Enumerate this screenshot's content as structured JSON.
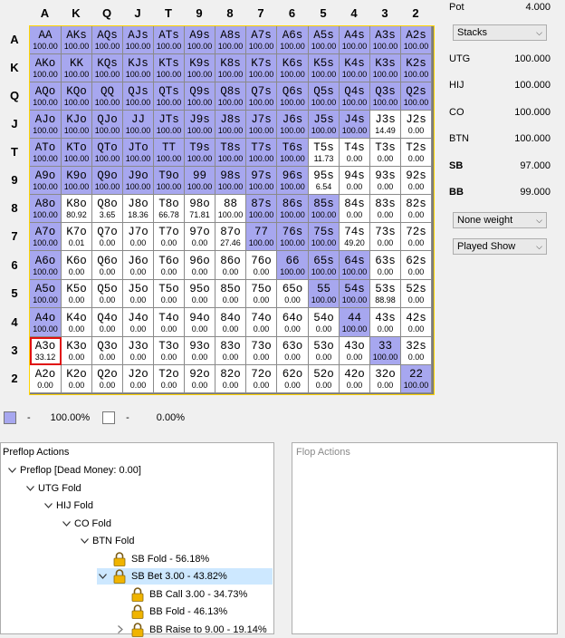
{
  "grid": {
    "ranks": [
      "A",
      "K",
      "Q",
      "J",
      "T",
      "9",
      "8",
      "7",
      "6",
      "5",
      "4",
      "3",
      "2"
    ],
    "rows": [
      [
        {
          "h": "AA",
          "v": "100.00"
        },
        {
          "h": "AKs",
          "v": "100.00"
        },
        {
          "h": "AQs",
          "v": "100.00"
        },
        {
          "h": "AJs",
          "v": "100.00"
        },
        {
          "h": "ATs",
          "v": "100.00"
        },
        {
          "h": "A9s",
          "v": "100.00"
        },
        {
          "h": "A8s",
          "v": "100.00"
        },
        {
          "h": "A7s",
          "v": "100.00"
        },
        {
          "h": "A6s",
          "v": "100.00"
        },
        {
          "h": "A5s",
          "v": "100.00"
        },
        {
          "h": "A4s",
          "v": "100.00"
        },
        {
          "h": "A3s",
          "v": "100.00"
        },
        {
          "h": "A2s",
          "v": "100.00"
        }
      ],
      [
        {
          "h": "AKo",
          "v": "100.00"
        },
        {
          "h": "KK",
          "v": "100.00"
        },
        {
          "h": "KQs",
          "v": "100.00"
        },
        {
          "h": "KJs",
          "v": "100.00"
        },
        {
          "h": "KTs",
          "v": "100.00"
        },
        {
          "h": "K9s",
          "v": "100.00"
        },
        {
          "h": "K8s",
          "v": "100.00"
        },
        {
          "h": "K7s",
          "v": "100.00"
        },
        {
          "h": "K6s",
          "v": "100.00"
        },
        {
          "h": "K5s",
          "v": "100.00"
        },
        {
          "h": "K4s",
          "v": "100.00"
        },
        {
          "h": "K3s",
          "v": "100.00"
        },
        {
          "h": "K2s",
          "v": "100.00"
        }
      ],
      [
        {
          "h": "AQo",
          "v": "100.00"
        },
        {
          "h": "KQo",
          "v": "100.00"
        },
        {
          "h": "QQ",
          "v": "100.00"
        },
        {
          "h": "QJs",
          "v": "100.00"
        },
        {
          "h": "QTs",
          "v": "100.00"
        },
        {
          "h": "Q9s",
          "v": "100.00"
        },
        {
          "h": "Q8s",
          "v": "100.00"
        },
        {
          "h": "Q7s",
          "v": "100.00"
        },
        {
          "h": "Q6s",
          "v": "100.00"
        },
        {
          "h": "Q5s",
          "v": "100.00"
        },
        {
          "h": "Q4s",
          "v": "100.00"
        },
        {
          "h": "Q3s",
          "v": "100.00"
        },
        {
          "h": "Q2s",
          "v": "100.00"
        }
      ],
      [
        {
          "h": "AJo",
          "v": "100.00"
        },
        {
          "h": "KJo",
          "v": "100.00"
        },
        {
          "h": "QJo",
          "v": "100.00"
        },
        {
          "h": "JJ",
          "v": "100.00"
        },
        {
          "h": "JTs",
          "v": "100.00"
        },
        {
          "h": "J9s",
          "v": "100.00"
        },
        {
          "h": "J8s",
          "v": "100.00"
        },
        {
          "h": "J7s",
          "v": "100.00"
        },
        {
          "h": "J6s",
          "v": "100.00"
        },
        {
          "h": "J5s",
          "v": "100.00"
        },
        {
          "h": "J4s",
          "v": "100.00"
        },
        {
          "h": "J3s",
          "v": "14.49"
        },
        {
          "h": "J2s",
          "v": "0.00"
        }
      ],
      [
        {
          "h": "ATo",
          "v": "100.00"
        },
        {
          "h": "KTo",
          "v": "100.00"
        },
        {
          "h": "QTo",
          "v": "100.00"
        },
        {
          "h": "JTo",
          "v": "100.00"
        },
        {
          "h": "TT",
          "v": "100.00"
        },
        {
          "h": "T9s",
          "v": "100.00"
        },
        {
          "h": "T8s",
          "v": "100.00"
        },
        {
          "h": "T7s",
          "v": "100.00"
        },
        {
          "h": "T6s",
          "v": "100.00"
        },
        {
          "h": "T5s",
          "v": "11.73"
        },
        {
          "h": "T4s",
          "v": "0.00"
        },
        {
          "h": "T3s",
          "v": "0.00"
        },
        {
          "h": "T2s",
          "v": "0.00"
        }
      ],
      [
        {
          "h": "A9o",
          "v": "100.00"
        },
        {
          "h": "K9o",
          "v": "100.00"
        },
        {
          "h": "Q9o",
          "v": "100.00"
        },
        {
          "h": "J9o",
          "v": "100.00"
        },
        {
          "h": "T9o",
          "v": "100.00"
        },
        {
          "h": "99",
          "v": "100.00"
        },
        {
          "h": "98s",
          "v": "100.00"
        },
        {
          "h": "97s",
          "v": "100.00"
        },
        {
          "h": "96s",
          "v": "100.00"
        },
        {
          "h": "95s",
          "v": "6.54"
        },
        {
          "h": "94s",
          "v": "0.00"
        },
        {
          "h": "93s",
          "v": "0.00"
        },
        {
          "h": "92s",
          "v": "0.00"
        }
      ],
      [
        {
          "h": "A8o",
          "v": "100.00"
        },
        {
          "h": "K8o",
          "v": "80.92"
        },
        {
          "h": "Q8o",
          "v": "3.65"
        },
        {
          "h": "J8o",
          "v": "18.36"
        },
        {
          "h": "T8o",
          "v": "66.78"
        },
        {
          "h": "98o",
          "v": "71.81"
        },
        {
          "h": "88",
          "v": "100.00"
        },
        {
          "h": "87s",
          "v": "100.00"
        },
        {
          "h": "86s",
          "v": "100.00"
        },
        {
          "h": "85s",
          "v": "100.00"
        },
        {
          "h": "84s",
          "v": "0.00"
        },
        {
          "h": "83s",
          "v": "0.00"
        },
        {
          "h": "82s",
          "v": "0.00"
        }
      ],
      [
        {
          "h": "A7o",
          "v": "100.00"
        },
        {
          "h": "K7o",
          "v": "0.01"
        },
        {
          "h": "Q7o",
          "v": "0.00"
        },
        {
          "h": "J7o",
          "v": "0.00"
        },
        {
          "h": "T7o",
          "v": "0.00"
        },
        {
          "h": "97o",
          "v": "0.00"
        },
        {
          "h": "87o",
          "v": "27.46"
        },
        {
          "h": "77",
          "v": "100.00"
        },
        {
          "h": "76s",
          "v": "100.00"
        },
        {
          "h": "75s",
          "v": "100.00"
        },
        {
          "h": "74s",
          "v": "49.20"
        },
        {
          "h": "73s",
          "v": "0.00"
        },
        {
          "h": "72s",
          "v": "0.00"
        }
      ],
      [
        {
          "h": "A6o",
          "v": "100.00"
        },
        {
          "h": "K6o",
          "v": "0.00"
        },
        {
          "h": "Q6o",
          "v": "0.00"
        },
        {
          "h": "J6o",
          "v": "0.00"
        },
        {
          "h": "T6o",
          "v": "0.00"
        },
        {
          "h": "96o",
          "v": "0.00"
        },
        {
          "h": "86o",
          "v": "0.00"
        },
        {
          "h": "76o",
          "v": "0.00"
        },
        {
          "h": "66",
          "v": "100.00"
        },
        {
          "h": "65s",
          "v": "100.00"
        },
        {
          "h": "64s",
          "v": "100.00"
        },
        {
          "h": "63s",
          "v": "0.00"
        },
        {
          "h": "62s",
          "v": "0.00"
        }
      ],
      [
        {
          "h": "A5o",
          "v": "100.00"
        },
        {
          "h": "K5o",
          "v": "0.00"
        },
        {
          "h": "Q5o",
          "v": "0.00"
        },
        {
          "h": "J5o",
          "v": "0.00"
        },
        {
          "h": "T5o",
          "v": "0.00"
        },
        {
          "h": "95o",
          "v": "0.00"
        },
        {
          "h": "85o",
          "v": "0.00"
        },
        {
          "h": "75o",
          "v": "0.00"
        },
        {
          "h": "65o",
          "v": "0.00"
        },
        {
          "h": "55",
          "v": "100.00"
        },
        {
          "h": "54s",
          "v": "100.00"
        },
        {
          "h": "53s",
          "v": "88.98"
        },
        {
          "h": "52s",
          "v": "0.00"
        }
      ],
      [
        {
          "h": "A4o",
          "v": "100.00"
        },
        {
          "h": "K4o",
          "v": "0.00"
        },
        {
          "h": "Q4o",
          "v": "0.00"
        },
        {
          "h": "J4o",
          "v": "0.00"
        },
        {
          "h": "T4o",
          "v": "0.00"
        },
        {
          "h": "94o",
          "v": "0.00"
        },
        {
          "h": "84o",
          "v": "0.00"
        },
        {
          "h": "74o",
          "v": "0.00"
        },
        {
          "h": "64o",
          "v": "0.00"
        },
        {
          "h": "54o",
          "v": "0.00"
        },
        {
          "h": "44",
          "v": "100.00"
        },
        {
          "h": "43s",
          "v": "0.00"
        },
        {
          "h": "42s",
          "v": "0.00"
        }
      ],
      [
        {
          "h": "A3o",
          "v": "33.12"
        },
        {
          "h": "K3o",
          "v": "0.00"
        },
        {
          "h": "Q3o",
          "v": "0.00"
        },
        {
          "h": "J3o",
          "v": "0.00"
        },
        {
          "h": "T3o",
          "v": "0.00"
        },
        {
          "h": "93o",
          "v": "0.00"
        },
        {
          "h": "83o",
          "v": "0.00"
        },
        {
          "h": "73o",
          "v": "0.00"
        },
        {
          "h": "63o",
          "v": "0.00"
        },
        {
          "h": "53o",
          "v": "0.00"
        },
        {
          "h": "43o",
          "v": "0.00"
        },
        {
          "h": "33",
          "v": "100.00"
        },
        {
          "h": "32s",
          "v": "0.00"
        }
      ],
      [
        {
          "h": "A2o",
          "v": "0.00"
        },
        {
          "h": "K2o",
          "v": "0.00"
        },
        {
          "h": "Q2o",
          "v": "0.00"
        },
        {
          "h": "J2o",
          "v": "0.00"
        },
        {
          "h": "T2o",
          "v": "0.00"
        },
        {
          "h": "92o",
          "v": "0.00"
        },
        {
          "h": "82o",
          "v": "0.00"
        },
        {
          "h": "72o",
          "v": "0.00"
        },
        {
          "h": "62o",
          "v": "0.00"
        },
        {
          "h": "52o",
          "v": "0.00"
        },
        {
          "h": "42o",
          "v": "0.00"
        },
        {
          "h": "32o",
          "v": "0.00"
        },
        {
          "h": "22",
          "v": "100.00"
        }
      ]
    ],
    "highlighted": [
      [
        1,
        1,
        1,
        1,
        1,
        1,
        1,
        1,
        1,
        1,
        1,
        1,
        1
      ],
      [
        1,
        1,
        1,
        1,
        1,
        1,
        1,
        1,
        1,
        1,
        1,
        1,
        1
      ],
      [
        1,
        1,
        1,
        1,
        1,
        1,
        1,
        1,
        1,
        1,
        1,
        1,
        1
      ],
      [
        1,
        1,
        1,
        1,
        1,
        1,
        1,
        1,
        1,
        1,
        1,
        0,
        0
      ],
      [
        1,
        1,
        1,
        1,
        1,
        1,
        1,
        1,
        1,
        0,
        0,
        0,
        0
      ],
      [
        1,
        1,
        1,
        1,
        1,
        1,
        1,
        1,
        1,
        0,
        0,
        0,
        0
      ],
      [
        1,
        0,
        0,
        0,
        0,
        0,
        0,
        1,
        1,
        1,
        0,
        0,
        0
      ],
      [
        1,
        0,
        0,
        0,
        0,
        0,
        0,
        1,
        1,
        1,
        0,
        0,
        0
      ],
      [
        1,
        0,
        0,
        0,
        0,
        0,
        0,
        0,
        1,
        1,
        1,
        0,
        0
      ],
      [
        1,
        0,
        0,
        0,
        0,
        0,
        0,
        0,
        0,
        1,
        1,
        0,
        0
      ],
      [
        1,
        0,
        0,
        0,
        0,
        0,
        0,
        0,
        0,
        0,
        1,
        0,
        0
      ],
      [
        0,
        0,
        0,
        0,
        0,
        0,
        0,
        0,
        0,
        0,
        0,
        1,
        0
      ],
      [
        0,
        0,
        0,
        0,
        0,
        0,
        0,
        0,
        0,
        0,
        0,
        0,
        1
      ]
    ],
    "selected_hand": "A3o",
    "full_color": "#a7a7ef",
    "empty_color": "#ffffff",
    "border_color": "#ffd400",
    "selected_color": "#e01010"
  },
  "side": {
    "pot_label": "Pot",
    "pot_value": "4.000",
    "mode_select": "Stacks",
    "stacks": [
      {
        "label": "UTG",
        "value": "100.000",
        "bold": false
      },
      {
        "label": "HIJ",
        "value": "100.000",
        "bold": false
      },
      {
        "label": "CO",
        "value": "100.000",
        "bold": false
      },
      {
        "label": "BTN",
        "value": "100.000",
        "bold": false
      },
      {
        "label": "SB",
        "value": "97.000",
        "bold": true
      },
      {
        "label": "BB",
        "value": "99.000",
        "bold": true
      }
    ],
    "weight_select": "None weight",
    "show_select": "Played Show"
  },
  "legend": {
    "full_dash": "-",
    "full_pct": "100.00%",
    "empty_dash": "-",
    "empty_pct": "0.00%"
  },
  "preflop": {
    "title": "Preflop Actions",
    "nodes": [
      {
        "label": "Preflop [Dead Money: 0.00]",
        "depth": 0,
        "twisty": "open",
        "lock": false,
        "selected": false
      },
      {
        "label": "UTG Fold",
        "depth": 1,
        "twisty": "open",
        "lock": false,
        "selected": false
      },
      {
        "label": "HIJ Fold",
        "depth": 2,
        "twisty": "open",
        "lock": false,
        "selected": false
      },
      {
        "label": "CO Fold",
        "depth": 3,
        "twisty": "open",
        "lock": false,
        "selected": false
      },
      {
        "label": "BTN Fold",
        "depth": 4,
        "twisty": "open",
        "lock": false,
        "selected": false
      },
      {
        "label": "SB Fold - 56.18%",
        "depth": 5,
        "twisty": "none",
        "lock": true,
        "selected": false
      },
      {
        "label": "SB Bet 3.00 - 43.82%",
        "depth": 5,
        "twisty": "open",
        "lock": true,
        "selected": true
      },
      {
        "label": "BB Call 3.00 - 34.73%",
        "depth": 6,
        "twisty": "none",
        "lock": true,
        "selected": false
      },
      {
        "label": "BB Fold - 46.13%",
        "depth": 6,
        "twisty": "none",
        "lock": true,
        "selected": false
      },
      {
        "label": "BB Raise to 9.00 - 19.14%",
        "depth": 6,
        "twisty": "closed",
        "lock": true,
        "selected": false
      }
    ]
  },
  "flop": {
    "title": "Flop Actions"
  }
}
